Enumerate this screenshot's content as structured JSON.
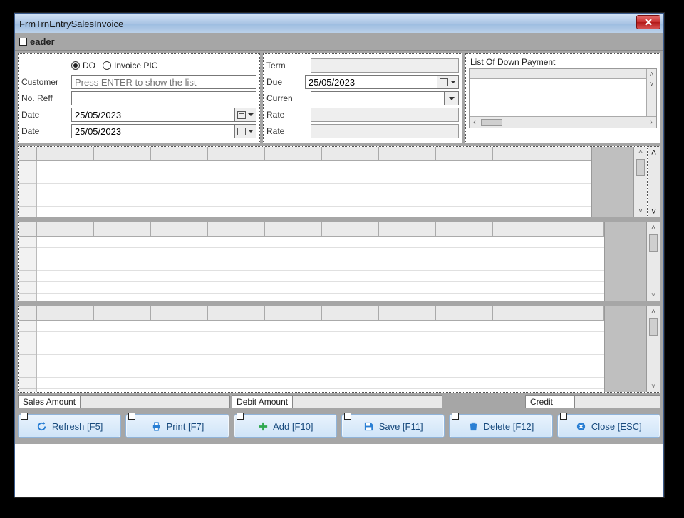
{
  "window": {
    "title": "FrmTrnEntrySalesInvoice"
  },
  "header": {
    "label": "eader"
  },
  "form": {
    "radios": {
      "do": "DO",
      "invoice_pic": "Invoice PIC",
      "selected": "do"
    },
    "customer_label": "Customer",
    "customer_placeholder": "Press ENTER to show the list",
    "noreff_label": "No. Reff",
    "noreff_value": "",
    "date1_label": "Date",
    "date1_value": "25/05/2023",
    "date2_label": "Date",
    "date2_value": "25/05/2023",
    "term_label": "Term",
    "term_value": "",
    "due_label": "Due",
    "due_value": "25/05/2023",
    "curren_label": "Curren",
    "curren_value": "",
    "rate1_label": "Rate",
    "rate1_value": "",
    "rate2_label": "Rate",
    "rate2_value": ""
  },
  "downpayment": {
    "title": "List Of  Down Payment"
  },
  "totals": {
    "sales_label": "Sales Amount",
    "debit_label": "Debit Amount",
    "credit_label": "Credit"
  },
  "toolbar": {
    "refresh": "Refresh [F5]",
    "print": "Print [F7]",
    "add": "Add [F10]",
    "save": "Save [F11]",
    "del": "Delete [F12]",
    "close": "Close [ESC]"
  }
}
